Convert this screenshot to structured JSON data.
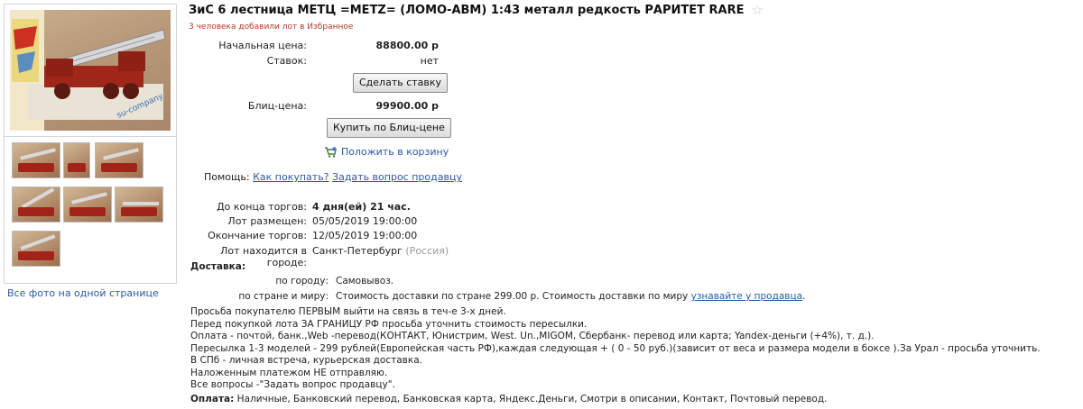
{
  "gallery": {
    "all_photos_link": "Все фото на одной странице",
    "watermark": "su-company"
  },
  "lot": {
    "title": "ЗиС 6 лестница МЕТЦ =METZ= (ЛОМО-АВМ) 1:43 металл редкость РАРИТЕТ RARE",
    "favorites_note": "3 человека добавили лот в Избранное"
  },
  "pricing": {
    "start_price_label": "Начальная цена:",
    "start_price": "88800.00 р",
    "bids_label": "Ставок:",
    "bids_value": "нет",
    "place_bid_button": "Сделать ставку",
    "blitz_label": "Блиц-цена:",
    "blitz_price": "99900.00 р",
    "buy_blitz_button": "Купить по Блиц-цене",
    "add_to_cart": "Положить в корзину"
  },
  "help": {
    "label": "Помощь:",
    "how_to_buy": "Как покупать?",
    "ask_seller": "Задать вопрос продавцу"
  },
  "timing": {
    "ends_label": "До конца торгов:",
    "ends_value": "4 дня(ей) 21 час.",
    "posted_label": "Лот размещен:",
    "posted_value": "05/05/2019 19:00:00",
    "end_label": "Окончание торгов:",
    "end_value": "12/05/2019 19:00:00",
    "city_label": "Лот находится в городе:",
    "city_value": "Санкт-Петербург",
    "country_value": "(Россия)"
  },
  "delivery": {
    "heading": "Доставка:",
    "city_label": "по городу:",
    "city_value": "Самовывоз.",
    "world_label": "по стране и миру:",
    "world_value": "Стоимость доставки по стране 299.00 р. Стоимость доставки по миру",
    "world_link": "узнавайте у продавца",
    "world_tail": "."
  },
  "description": {
    "lines": [
      "Просьба покупателю ПЕРВЫМ выйти на связь в теч-е 3-х дней.",
      "Перед покупкой лота ЗА ГРАНИЦУ РФ просьба уточнить стоимость пересылки.",
      "Оплата - почтой, банк.,Web -перевод(КОНТАКТ, Юнистрим, West. Un.,MIGOM, Сбербанк- перевод или карта; Yandex-деньги (+4%), т. д.).",
      "Пересылка 1-3 моделей - 299 рублей(Европейская часть РФ),каждая следующая + ( 0 - 50 руб.)(зависит от веса и размера модели в боксе ).За Урал - просьба уточнить.",
      "В СПб - личная встреча, курьерская доставка.",
      "Наложенным платежом НЕ отправляю.",
      "Все вопросы -\"Задать вопрос продавцу\"."
    ],
    "payment_label": "Оплата:",
    "payment_value": "Наличные, Банковский перевод, Банковская карта, Яндекс.Деньги, Смотри в описании, Контакт, Почтовый перевод."
  }
}
